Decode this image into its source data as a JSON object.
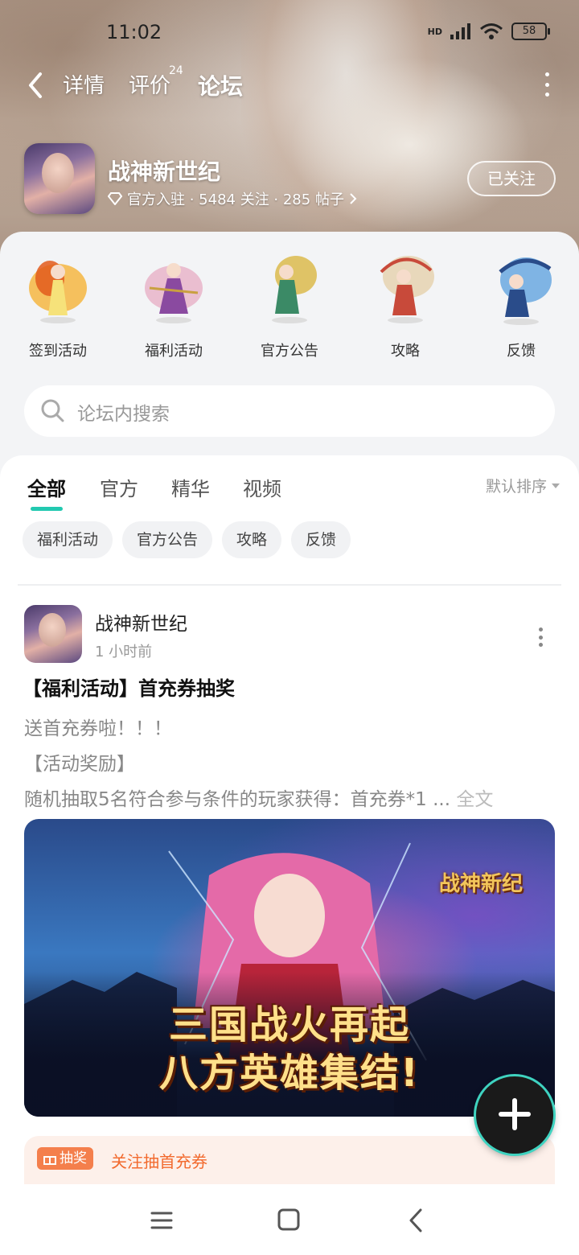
{
  "status_bar": {
    "time": "11:02",
    "network": "HD",
    "battery": "58"
  },
  "nav": {
    "tabs": [
      {
        "label": "详情"
      },
      {
        "label": "评价",
        "badge": "24"
      },
      {
        "label": "论坛"
      }
    ],
    "active_tab": "论坛"
  },
  "game": {
    "name": "战神新世纪",
    "meta": "官方入驻 · 5484 关注 · 285 帖子",
    "follow_label": "已关注"
  },
  "shortcuts": [
    {
      "label": "签到活动",
      "colors": [
        "#f0a030",
        "#e25a1c"
      ]
    },
    {
      "label": "福利活动",
      "colors": [
        "#e59ab8",
        "#8a4aa0"
      ]
    },
    {
      "label": "官方公告",
      "colors": [
        "#d9b742",
        "#3b8a66"
      ]
    },
    {
      "label": "攻略",
      "colors": [
        "#e7d5b5",
        "#c84a3a"
      ]
    },
    {
      "label": "反馈",
      "colors": [
        "#6aa8e0",
        "#2a4c8a"
      ]
    }
  ],
  "search": {
    "placeholder": "论坛内搜索"
  },
  "feed": {
    "tabs": [
      "全部",
      "官方",
      "精华",
      "视频"
    ],
    "active_tab": "全部",
    "sort_label": "默认排序",
    "chips": [
      "福利活动",
      "官方公告",
      "攻略",
      "反馈"
    ]
  },
  "post": {
    "author": "战神新世纪",
    "time": "1 小时前",
    "title": "【福利活动】首充券抽奖",
    "lines": [
      "送首充券啦！！！",
      "【活动奖励】",
      "随机抽取5名符合参与条件的玩家获得：首充券*1 ..."
    ],
    "read_more": "全文",
    "banner": {
      "logo": "战神新纪",
      "line1": "三国战火再起",
      "line2": "八方英雄集结!"
    },
    "promo": {
      "tag": "抽奖",
      "text": "关注抽首充券"
    }
  },
  "colors": {
    "accent": "#22c9b0",
    "promo": "#f26a2e"
  }
}
